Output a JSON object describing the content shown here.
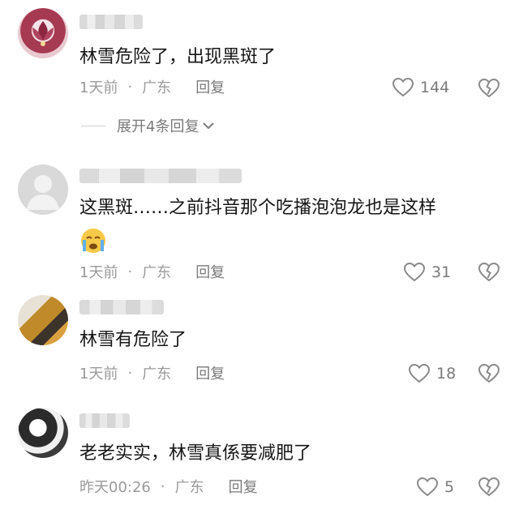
{
  "comments": [
    {
      "text": "林雪危险了，出现黑斑了",
      "time": "1天前",
      "location": "广东",
      "reply_label": "回复",
      "likes": "144"
    },
    {
      "text": "这黑斑……之前抖音那个吃播泡泡龙也是这样",
      "emoji": "crying-face",
      "time": "1天前",
      "location": "广东",
      "reply_label": "回复",
      "likes": "31"
    },
    {
      "text": "林雪有危险了",
      "time": "1天前",
      "location": "广东",
      "reply_label": "回复",
      "likes": "18"
    },
    {
      "text": "老老实实，林雪真係要减肥了",
      "time": "昨天00:26",
      "location": "广东",
      "reply_label": "回复",
      "likes": "5"
    }
  ],
  "expand_replies": "展开4条回复",
  "separator": "·",
  "colors": {
    "text": "#161616",
    "meta": "#9a9a9a",
    "icon": "#8a8a8a"
  }
}
